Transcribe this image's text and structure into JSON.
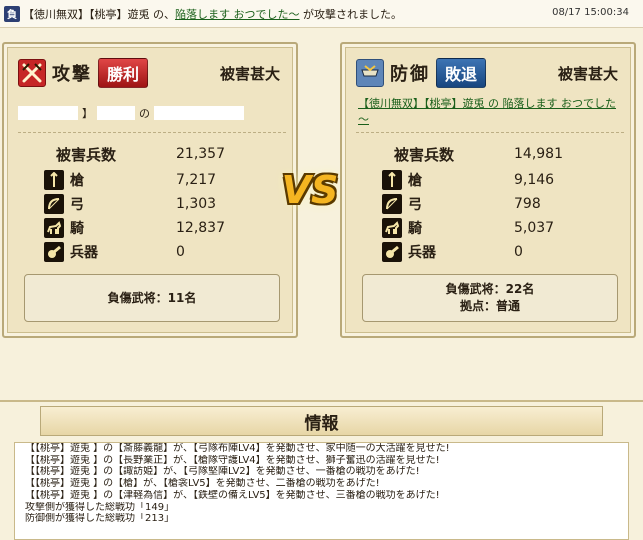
{
  "header": {
    "result_mark": "負",
    "message_prefix": "【徳川無双】【桃亭】遊兎 の、",
    "target_name": "陥落します おつでした～",
    "message_suffix": " が攻撃されました。",
    "timestamp": "08/17 15:00:34"
  },
  "attacker": {
    "side_label": "攻撃",
    "outcome": "勝利",
    "damage_level": "被害甚大",
    "player_bracket": "】",
    "player_no": "の",
    "losses_label": "被害兵数",
    "losses_total": "21,357",
    "units": [
      {
        "name": "槍",
        "count": "7,217",
        "icon": "spear-icon"
      },
      {
        "name": "弓",
        "count": "1,303",
        "icon": "bow-icon"
      },
      {
        "name": "騎",
        "count": "12,837",
        "icon": "horse-icon"
      },
      {
        "name": "兵器",
        "count": "0",
        "icon": "siege-icon"
      }
    ],
    "injured_generals": "負傷武将：11名"
  },
  "defender": {
    "side_label": "防御",
    "outcome": "敗退",
    "damage_level": "被害甚大",
    "line_prefix": "【徳川無双】【桃亭】遊兎 の ",
    "line_target": "陥落します おつでした～",
    "losses_label": "被害兵数",
    "losses_total": "14,981",
    "units": [
      {
        "name": "槍",
        "count": "9,146",
        "icon": "spear-icon"
      },
      {
        "name": "弓",
        "count": "798",
        "icon": "bow-icon"
      },
      {
        "name": "騎",
        "count": "5,037",
        "icon": "horse-icon"
      },
      {
        "name": "兵器",
        "count": "0",
        "icon": "siege-icon"
      }
    ],
    "injured_generals": "負傷武将：22名",
    "base_type": "拠点：普通"
  },
  "vs_label": "VS",
  "info": {
    "title": "情報",
    "lines": [
      "【【桃亭】遊兎 】の【斎藤義龍】が、【弓隊布陣LV4】を発動させ、家中随一の大活躍を見せた!",
      "【【桃亭】遊兎 】の【長野業正】が、【槍隊守護LV4】を発動させ、獅子奮迅の活躍を見せた!",
      "【【桃亭】遊兎 】の【諏訪姫】が、【弓隊堅陣LV2】を発動させ、一番槍の戦功をあげた!",
      "【【桃亭】遊兎 】の【槍】が、【槍衾LV5】を発動させ、二番槍の戦功をあげた!",
      "【【桃亭】遊兎 】の【津軽為信】が、【鉄壁の備えLV5】を発動させ、三番槍の戦功をあげた!",
      "攻撃側が獲得した総戦功「149」",
      "防御側が獲得した総戦功「213」"
    ]
  },
  "colors": {
    "win": "#c62626",
    "lose": "#18467f",
    "link": "#1a5f1a",
    "vs": "#f5b521"
  }
}
